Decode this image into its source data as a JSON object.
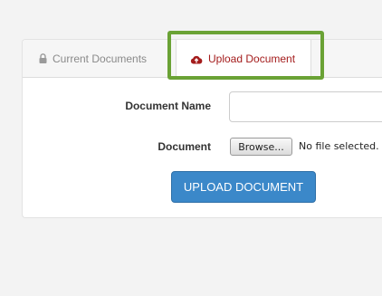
{
  "tabs": {
    "current": {
      "label": "Current Documents",
      "icon": "lock-icon"
    },
    "upload": {
      "label": "Upload Document",
      "icon": "cloud-upload-icon"
    }
  },
  "form": {
    "document_name_label": "Document Name",
    "document_name_value": "",
    "document_name_placeholder": "",
    "document_label": "Document",
    "browse_label": "Browse...",
    "file_status": "No file selected.",
    "submit_label": "UPLOAD DOCUMENT"
  },
  "colors": {
    "highlight": "#6aa235",
    "active_tab_text": "#a41c1c",
    "primary_button": "#3b88c9"
  }
}
